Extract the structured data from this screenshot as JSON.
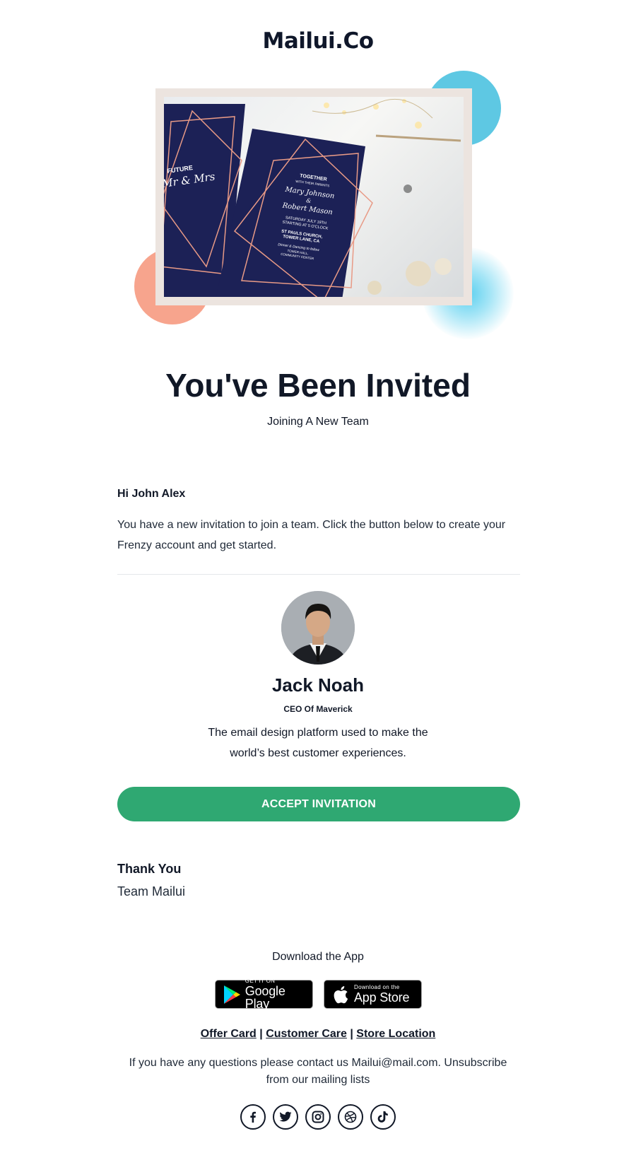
{
  "brand": {
    "logo": "Mailui.Co"
  },
  "hero": {
    "card_left": {
      "line1": "FUTURE",
      "line2": "Mr & Mrs"
    },
    "card_right": {
      "line1": "TOGETHER",
      "line2": "WITH THEIR PARENTS",
      "line3": "Mary Johnson",
      "line4": "&",
      "line5": "Robert Mason",
      "line6": "SATURDAY JULY 19TH",
      "line7": "STARTING AT 5 O'CLOCK",
      "line8": "ST PAULS CHURCH,",
      "line9": "TOWER LANE, CA",
      "line10": "Dinner & Dancing to follow",
      "line11": "TOWER HALL,",
      "line12": "COMMUNITY CENTER"
    }
  },
  "header": {
    "title": "You've Been Invited",
    "subtitle": "Joining A New Team"
  },
  "body": {
    "greeting": "Hi John Alex",
    "intro": "You have a new invitation to join a team. Click the button below to create your Frenzy account and get started."
  },
  "profile": {
    "name": "Jack Noah",
    "role": "CEO Of Maverick",
    "description": "The email design platform used to make the world’s best customer experiences."
  },
  "cta": {
    "label": "ACCEPT INVITATION"
  },
  "signoff": {
    "thanks": "Thank You",
    "team": "Team Mailui"
  },
  "footer": {
    "download_label": "Download the App",
    "google_play": {
      "small": "GET IT ON",
      "big": "Google Play"
    },
    "app_store": {
      "small": "Download on the",
      "big": "App Store"
    },
    "links": [
      "Offer Card",
      "Customer Care",
      "Store Location"
    ],
    "separator": "|",
    "contact": "If you have any questions please contact us Mailui@mail.com. Unsubscribe from our mailing lists",
    "social": [
      "facebook-icon",
      "twitter-icon",
      "instagram-icon",
      "dribbble-icon",
      "tiktok-icon"
    ]
  },
  "colors": {
    "accent_green": "#2fa872",
    "blob_blue": "#5ec8e3",
    "blob_salmon": "#f7a48d",
    "card_navy": "#1c2156",
    "foil_rose": "#e89a86"
  }
}
